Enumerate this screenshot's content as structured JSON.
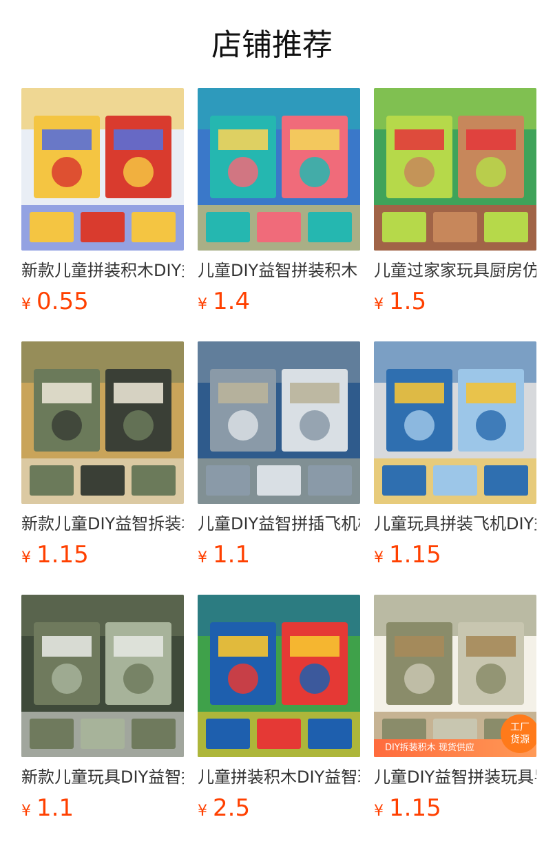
{
  "title": "店铺推荐",
  "currency": "¥",
  "products": [
    {
      "name": "新款儿童拼装积木DIY益智",
      "price": "0.55",
      "img": "block-figures-image",
      "palette": [
        "#f4c542",
        "#d93b2e",
        "#5a6fd6",
        "#e9eef5"
      ]
    },
    {
      "name": "儿童DIY益智拼装积木",
      "price": "1.4",
      "img": "bricks-boxes-image",
      "palette": [
        "#25b7b0",
        "#f06b7a",
        "#f3d35a",
        "#3a78c9"
      ]
    },
    {
      "name": "儿童过家家玩具厨房仿真",
      "price": "1.5",
      "img": "burger-toy-image",
      "palette": [
        "#b6d94a",
        "#c7875b",
        "#e23b3b",
        "#3fa35a"
      ]
    },
    {
      "name": "新款儿童DIY益智拆装坦克",
      "price": "1.15",
      "img": "tank-pack-image",
      "palette": [
        "#6b7a5a",
        "#3a3f36",
        "#e8e2d2",
        "#c9a45a"
      ]
    },
    {
      "name": "儿童DIY益智拼插飞机模型",
      "price": "1.1",
      "img": "airplane-box-image",
      "palette": [
        "#8a9aa8",
        "#d9dfe4",
        "#b9b49a",
        "#2f5b8c"
      ]
    },
    {
      "name": "儿童玩具拼装飞机DIY益智",
      "price": "1.15",
      "img": "jet-pack-image",
      "palette": [
        "#2f6fb0",
        "#9cc6e8",
        "#f2c23a",
        "#d7d9dc"
      ]
    },
    {
      "name": "新款儿童玩具DIY益智拼装",
      "price": "1.1",
      "img": "military-truck-image",
      "palette": [
        "#6f7a5d",
        "#a7b39a",
        "#e3e5e0",
        "#3f4a3a"
      ]
    },
    {
      "name": "儿童拼装积木DIY益智玩具",
      "price": "2.5",
      "img": "toy-boxes-image",
      "palette": [
        "#1e5fae",
        "#e53935",
        "#f6c430",
        "#3fa14a"
      ]
    },
    {
      "name": "儿童DIY益智拼装玩具导弹",
      "price": "1.15",
      "img": "missile-truck-image",
      "palette": [
        "#8a8c6a",
        "#c8c6b0",
        "#a68a5a",
        "#f4f1e8"
      ],
      "badge": [
        "工厂",
        "货源"
      ],
      "banner": "DIY拆装积木  现货供应"
    }
  ]
}
